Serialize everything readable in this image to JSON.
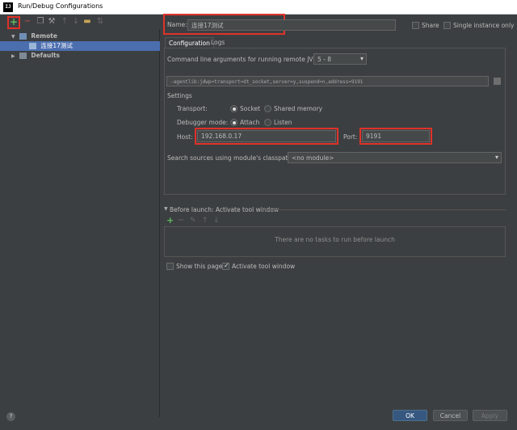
{
  "window": {
    "title": "Run/Debug Configurations",
    "app_icon": "IJ"
  },
  "toolbar": {
    "icons": [
      "plus-icon",
      "minus-icon",
      "copy-icon",
      "wrench-icon",
      "arrow-up-icon",
      "arrow-down-icon",
      "folder-icon",
      "sort-icon"
    ]
  },
  "tree": {
    "remote_label": "Remote",
    "config_label": "连接17测试",
    "defaults_label": "Defaults"
  },
  "name_row": {
    "label": "Name:",
    "value": "连接17测试",
    "share_label": "Share",
    "single_instance_label": "Single instance only"
  },
  "tabs": [
    "Configuration",
    "Logs"
  ],
  "config": {
    "cmd_label": "Command line arguments for running remote JVM",
    "jvm_version": "5 - 8",
    "agent_args": "-agentlib:jdwp=transport=dt_socket,server=y,suspend=n,address=9191",
    "settings_label": "Settings",
    "transport_label": "Transport:",
    "transport_socket": "Socket",
    "transport_shared": "Shared memory",
    "debugger_label": "Debugger mode:",
    "debugger_attach": "Attach",
    "debugger_listen": "Listen",
    "host_label": "Host:",
    "host_value": "192.168.0.17",
    "port_label": "Port:",
    "port_value": "9191",
    "classpath_label": "Search sources using module's classpath:",
    "classpath_value": "<no module>"
  },
  "before_launch": {
    "header": "Before launch: Activate tool window",
    "empty_text": "There are no tasks to run before launch",
    "show_page_label": "Show this page",
    "activate_label": "Activate tool window"
  },
  "buttons": {
    "ok": "OK",
    "cancel": "Cancel",
    "apply": "Apply"
  },
  "colors": {
    "background": "#3c3f41",
    "selection": "#4b6eaf",
    "highlight": "#e0322a",
    "primary_button": "#365880"
  }
}
